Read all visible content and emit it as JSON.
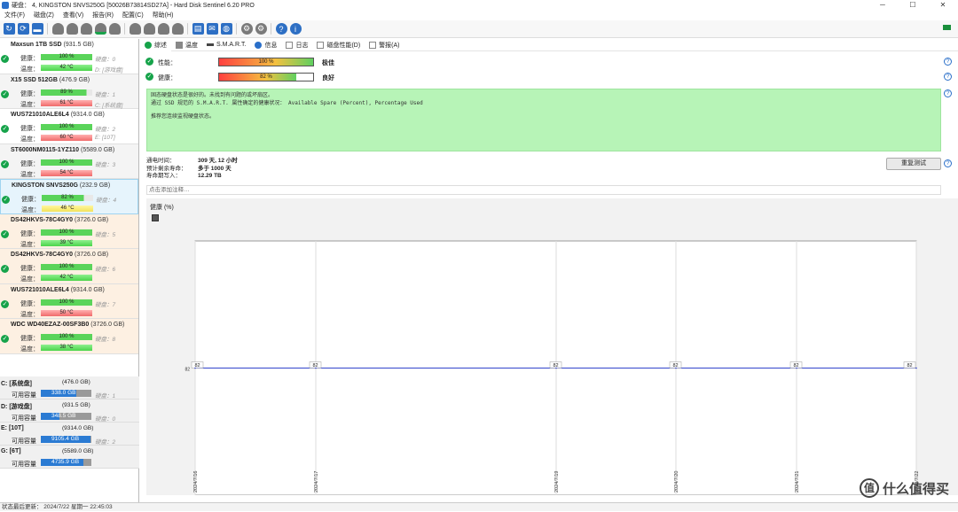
{
  "window": {
    "title": "硬盘： 4, KINGSTON SNVS250G [50026B73814SD27A] - Hard Disk Sentinel 6.20 PRO",
    "minimize_glyph": "─",
    "maximize_glyph": "☐",
    "close_glyph": "✕"
  },
  "menu": [
    "文件(F)",
    "磁盘(Z)",
    "查看(V)",
    "报告(R)",
    "配置(C)",
    "帮助(H)"
  ],
  "toolbar_icons": [
    "refresh-icon",
    "refresh-all-icon",
    "disk-icon",
    "disk-health-icon",
    "disk-temp-icon",
    "disk-log-icon",
    "disk-green-icon",
    "disk-warn-icon",
    "disk-info-icon",
    "disk-tool-icon",
    "disk-test-icon",
    "report-icon",
    "email-icon",
    "network-icon",
    "settings-icon",
    "config-icon",
    "help-icon",
    "info-icon"
  ],
  "labels": {
    "health": "健康：",
    "temp": "温度："
  },
  "disks": [
    {
      "name": "Maxsun 1TB SSD",
      "capacity": "(931.5 GB)",
      "health": "100 %",
      "health_pct": 100,
      "temp": "42 °C",
      "temp_color": "green",
      "disk_label": "硬盘：0",
      "drive_label": "D: [游戏盘]",
      "style": "plain"
    },
    {
      "name": "X15 SSD 512GB",
      "capacity": "(476.9 GB)",
      "health": "89 %",
      "health_pct": 89,
      "temp": "61 °C",
      "temp_color": "red",
      "disk_label": "硬盘：1",
      "drive_label": "C: [系统盘]",
      "style": "light"
    },
    {
      "name": "WUS721010ALE6L4",
      "capacity": "(9314.0 GB)",
      "health": "100 %",
      "health_pct": 100,
      "temp": "60 °C",
      "temp_color": "red",
      "disk_label": "硬盘：2",
      "drive_label": "E: [10T]",
      "style": "plain"
    },
    {
      "name": "ST6000NM0115-1YZ110",
      "capacity": "(5589.0 GB)",
      "health": "100 %",
      "health_pct": 100,
      "temp": "54 °C",
      "temp_color": "red",
      "disk_label": "硬盘：3",
      "drive_label": "",
      "style": "light"
    },
    {
      "name": "KINGSTON SNVS250G",
      "capacity": "(232.9 GB)",
      "health": "82 %",
      "health_pct": 82,
      "temp": "46 °C",
      "temp_color": "yellow",
      "disk_label": "硬盘：4",
      "drive_label": "",
      "style": "sel"
    },
    {
      "name": "DS42HKVS-78C4GY0",
      "capacity": "(3726.0 GB)",
      "health": "100 %",
      "health_pct": 100,
      "temp": "39 °C",
      "temp_color": "green",
      "disk_label": "硬盘：5",
      "drive_label": "",
      "style": "orange"
    },
    {
      "name": "DS42HKVS-78C4GY0",
      "capacity": "(3726.0 GB)",
      "health": "100 %",
      "health_pct": 100,
      "temp": "42 °C",
      "temp_color": "green",
      "disk_label": "硬盘：6",
      "drive_label": "",
      "style": "orange"
    },
    {
      "name": "WUS721010ALE6L4",
      "capacity": "(9314.0 GB)",
      "health": "100 %",
      "health_pct": 100,
      "temp": "50 °C",
      "temp_color": "red",
      "disk_label": "硬盘：7",
      "drive_label": "",
      "style": "orange"
    },
    {
      "name": "WDC WD40EZAZ-00SF3B0",
      "capacity": "(3726.0 GB)",
      "health": "100 %",
      "health_pct": 100,
      "temp": "38 °C",
      "temp_color": "green",
      "disk_label": "硬盘：8",
      "drive_label": "",
      "style": "orange"
    }
  ],
  "volumes": [
    {
      "name": "C: [系统盘]",
      "size": "(476.0 GB)",
      "free_label": "可用容量",
      "free": "338.0 GB",
      "free_pct": 71,
      "disk_label": "硬盘：1"
    },
    {
      "name": "D: [游戏盘]",
      "size": "(931.5 GB)",
      "free_label": "可用容量",
      "free": "348.5 GB",
      "free_pct": 37,
      "disk_label": "硬盘：0"
    },
    {
      "name": "E: [10T]",
      "size": "(9314.0 GB)",
      "free_label": "可用容量",
      "free": "9105.4 GB",
      "free_pct": 98,
      "disk_label": "硬盘：2"
    },
    {
      "name": "G: [6T]",
      "size": "(5589.0 GB)",
      "free_label": "可用容量",
      "free": "4735.9 GB",
      "free_pct": 85,
      "disk_label": ""
    }
  ],
  "tabs": [
    "综述",
    "温度",
    "S.M.A.R.T.",
    "信息",
    "日志",
    "磁盘性能(D)",
    "警报(A)"
  ],
  "performance": {
    "label": "性能：",
    "value": "100 %",
    "pct": 100,
    "status": "极佳"
  },
  "health": {
    "label": "健康：",
    "value": "82 %",
    "pct": 82,
    "status": "良好"
  },
  "message_lines": [
    "固态硬盘状态是很好的。未找到有问题的或坏扇区。",
    "通过 SSD 规范的 S.M.A.R.T. 属性确定的健康状况：  Available Spare (Percent), Percentage Used",
    "",
    "推荐您连续监视硬盘状态。"
  ],
  "stats": [
    {
      "label": "通电时间：",
      "value": "309 天, 12 小时"
    },
    {
      "label": "预计剩余寿命：",
      "value": "多于 1000 天"
    },
    {
      "label": "寿命期写入：",
      "value": "12.29 TB"
    }
  ],
  "retest_button": "重复测试",
  "note_placeholder": "点击添加注释…",
  "chart_data": {
    "type": "line",
    "title": "健康 (%)",
    "x": [
      "2024/7/16",
      "2024/7/17",
      "2024/7/19",
      "2024/7/20",
      "2024/7/21",
      "2024/7/22"
    ],
    "values": [
      82,
      82,
      82,
      82,
      82,
      82
    ],
    "ylim": [
      0,
      164
    ],
    "y_tick_label": "82",
    "grid": true
  },
  "statusbar": "状态最后更新：  2024/7/22 星期一 22:45:03",
  "watermark": "什么值得买"
}
